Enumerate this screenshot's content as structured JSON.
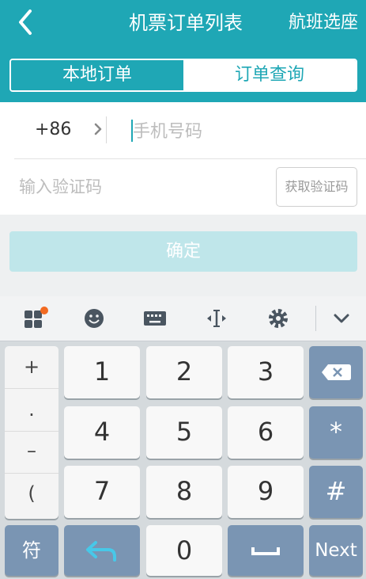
{
  "header": {
    "title": "机票订单列表",
    "right_link": "航班选座",
    "tabs": [
      {
        "label": "本地订单",
        "active": true
      },
      {
        "label": "订单查询",
        "active": false
      }
    ],
    "color": "#1fa7b5"
  },
  "form": {
    "country_code": "+86",
    "phone_placeholder": "手机号码",
    "code_placeholder": "输入验证码",
    "get_code_label": "获取验证码",
    "confirm_label": "确定"
  },
  "keyboard": {
    "toolbar_icons": [
      "apps-icon",
      "emoji-icon",
      "keyboard-icon",
      "cursor-icon",
      "settings-icon",
      "collapse-icon"
    ],
    "symbols": [
      "+",
      ".",
      "–",
      "("
    ],
    "digits": [
      "1",
      "2",
      "3",
      "4",
      "5",
      "6",
      "7",
      "8",
      "9",
      "0"
    ],
    "star": "*",
    "hash": "#",
    "fu_label": "符",
    "next_label": "Next",
    "key_color": "#7a95b3"
  }
}
